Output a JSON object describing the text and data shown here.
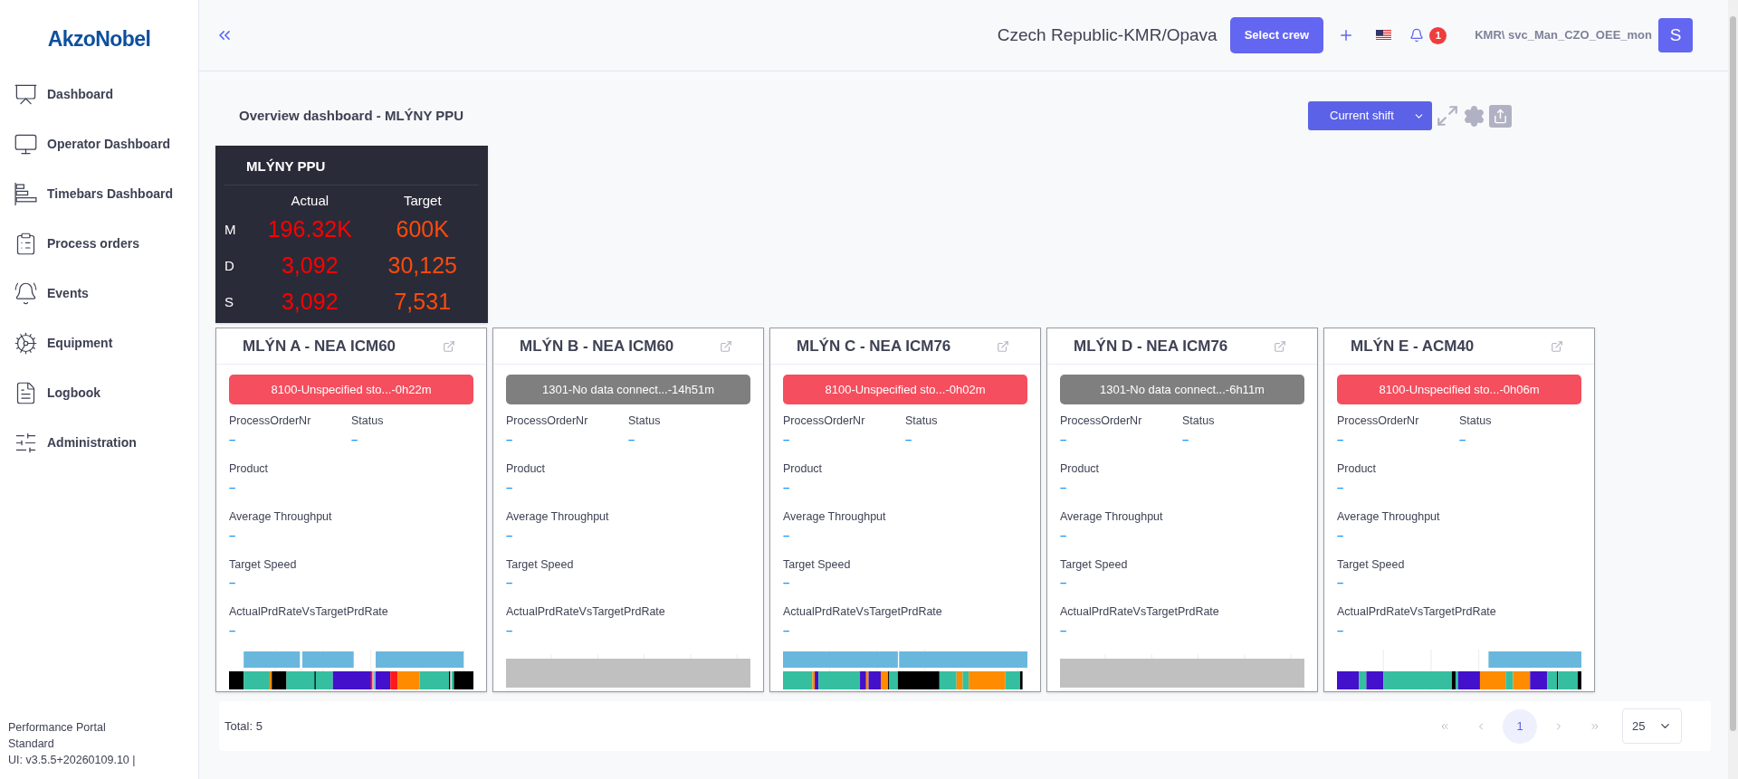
{
  "sidebar": {
    "logo": "AkzoNobel",
    "items": [
      {
        "label": "Dashboard"
      },
      {
        "label": "Operator Dashboard"
      },
      {
        "label": "Timebars Dashboard"
      },
      {
        "label": "Process orders"
      },
      {
        "label": "Events"
      },
      {
        "label": "Equipment"
      },
      {
        "label": "Logbook"
      },
      {
        "label": "Administration"
      }
    ],
    "footer": [
      "Performance Portal",
      "Standard",
      "UI: v3.5.5+20260109.10 |"
    ]
  },
  "header": {
    "site": "Czech Republic-KMR/Opava",
    "select_crew": "Select crew",
    "notifications": "1",
    "user": "KMR\\ svc_Man_CZO_OEE_mon",
    "avatar": "S"
  },
  "page": {
    "title": "Overview dashboard - MLÝNY PPU",
    "shift": "Current shift"
  },
  "summary": {
    "title": "MLÝNY PPU",
    "columns": [
      "Actual",
      "Target"
    ],
    "rows": [
      {
        "label": "M",
        "actual": "196.32K",
        "target": "600K"
      },
      {
        "label": "D",
        "actual": "3,092",
        "target": "30,125"
      },
      {
        "label": "S",
        "actual": "3,092",
        "target": "7,531"
      }
    ]
  },
  "cards": [
    {
      "title": "MLÝN A - NEA ICM60",
      "status": {
        "kind": "stopped",
        "text": "8100-Unspecified sto...-0h22m"
      },
      "fields": [
        {
          "label": "ProcessOrderNr",
          "value": "–"
        },
        {
          "label": "Status",
          "value": "–"
        },
        {
          "label": "Product",
          "value": "–"
        },
        {
          "label": "Average Throughput",
          "value": "–"
        },
        {
          "label": "Target Speed",
          "value": "–"
        },
        {
          "label": "ActualPrdRateVsTargetPrdRate",
          "value": "–"
        }
      ]
    },
    {
      "title": "MLÝN B - NEA ICM60",
      "status": {
        "kind": "no_data",
        "text": "1301-No data connect...-14h51m"
      },
      "fields": [
        {
          "label": "ProcessOrderNr",
          "value": "–"
        },
        {
          "label": "Status",
          "value": "–"
        },
        {
          "label": "Product",
          "value": "–"
        },
        {
          "label": "Average Throughput",
          "value": "–"
        },
        {
          "label": "Target Speed",
          "value": "–"
        },
        {
          "label": "ActualPrdRateVsTargetPrdRate",
          "value": "–"
        }
      ]
    },
    {
      "title": "MLÝN C - NEA ICM76",
      "status": {
        "kind": "stopped",
        "text": "8100-Unspecified sto...-0h02m"
      },
      "fields": [
        {
          "label": "ProcessOrderNr",
          "value": "–"
        },
        {
          "label": "Status",
          "value": "–"
        },
        {
          "label": "Product",
          "value": "–"
        },
        {
          "label": "Average Throughput",
          "value": "–"
        },
        {
          "label": "Target Speed",
          "value": "–"
        },
        {
          "label": "ActualPrdRateVsTargetPrdRate",
          "value": "–"
        }
      ]
    },
    {
      "title": "MLÝN D - NEA ICM76",
      "status": {
        "kind": "no_data",
        "text": "1301-No data connect...-6h11m"
      },
      "fields": [
        {
          "label": "ProcessOrderNr",
          "value": "–"
        },
        {
          "label": "Status",
          "value": "–"
        },
        {
          "label": "Product",
          "value": "–"
        },
        {
          "label": "Average Throughput",
          "value": "–"
        },
        {
          "label": "Target Speed",
          "value": "–"
        },
        {
          "label": "ActualPrdRateVsTargetPrdRate",
          "value": "–"
        }
      ]
    },
    {
      "title": "MLÝN E - ACM40",
      "status": {
        "kind": "stopped",
        "text": "8100-Unspecified sto...-0h06m"
      },
      "fields": [
        {
          "label": "ProcessOrderNr",
          "value": "–"
        },
        {
          "label": "Status",
          "value": "–"
        },
        {
          "label": "Product",
          "value": "–"
        },
        {
          "label": "Average Throughput",
          "value": "–"
        },
        {
          "label": "Target Speed",
          "value": "–"
        },
        {
          "label": "ActualPrdRateVsTargetPrdRate",
          "value": "–"
        }
      ]
    }
  ],
  "footer": {
    "total": "Total: 5",
    "pages": [
      {
        "label": "1",
        "selected": true
      }
    ],
    "page_size": "25"
  }
}
